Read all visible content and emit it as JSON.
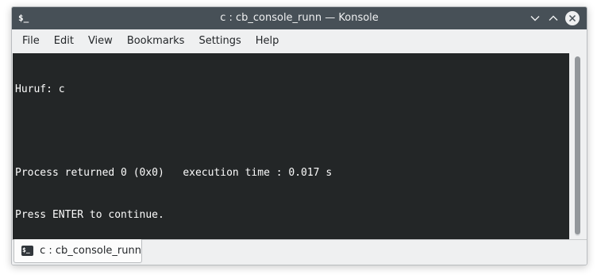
{
  "window": {
    "title": "c : cb_console_runn — Konsole",
    "app_icon_glyph": "$_",
    "icons": {
      "minimize": "chevron-down-icon",
      "maximize": "chevron-up-icon",
      "close": "close-icon"
    }
  },
  "menubar": {
    "items": [
      "File",
      "Edit",
      "View",
      "Bookmarks",
      "Settings",
      "Help"
    ]
  },
  "terminal": {
    "lines": [
      "Huruf: c",
      "",
      "Process returned 0 (0x0)   execution time : 0.017 s",
      "Press ENTER to continue."
    ],
    "background_color": "#232627",
    "text_color": "#fcfcfc"
  },
  "tabs": [
    {
      "label": "c : cb_console_runn",
      "icon": "terminal-icon",
      "icon_glyph": "$_"
    }
  ],
  "colors": {
    "titlebar": "#475057",
    "chrome": "#eff0f1"
  }
}
